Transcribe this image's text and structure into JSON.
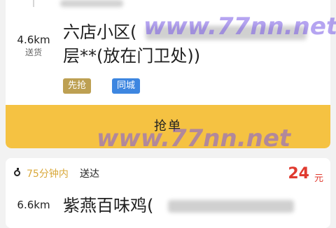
{
  "order1": {
    "distance": "4.6km",
    "distance_sub": "送货",
    "address_line1": "六店小区(",
    "address_line2": "层**(放在门卫处))",
    "tags": [
      "先抢",
      "同城"
    ],
    "tag_colors": [
      "#bda052",
      "#3d86e0"
    ],
    "grab_label": "抢单"
  },
  "order2": {
    "time_label": "75分钟内",
    "deliver_label": "送达",
    "price": "24",
    "price_unit": "元",
    "price_color": "#e03a2f",
    "time_color": "#d9a83a",
    "distance": "6.6km",
    "address_line1": "紫燕百味鸡("
  },
  "watermarks": [
    "www.77nn.net",
    "www.77nn.net"
  ],
  "colors": {
    "button": "#f5c242",
    "background": "#f2f2f2"
  }
}
